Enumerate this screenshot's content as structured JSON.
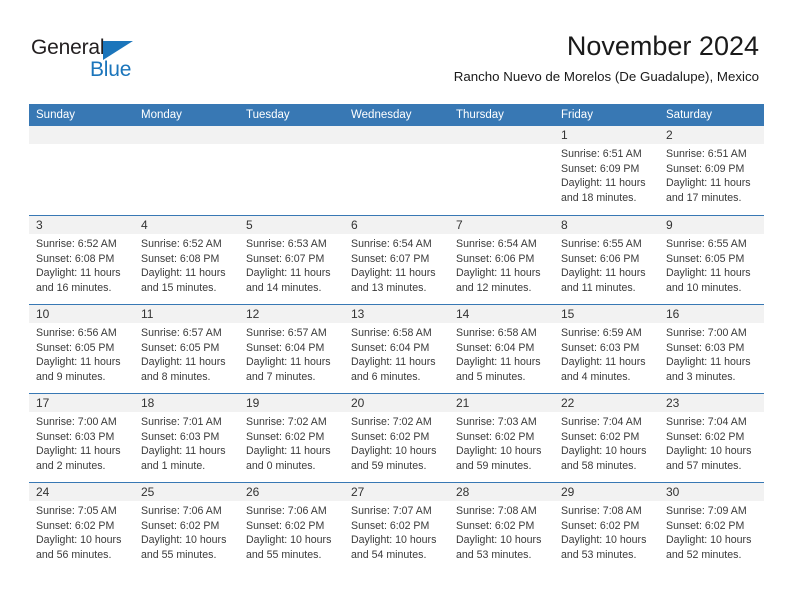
{
  "brand": {
    "name_part1": "General",
    "name_part2": "Blue",
    "accent_color": "#1b75bb"
  },
  "header": {
    "month_title": "November 2024",
    "location": "Rancho Nuevo de Morelos (De Guadalupe), Mexico"
  },
  "calendar": {
    "header_bg": "#3878b4",
    "weekdays": [
      "Sunday",
      "Monday",
      "Tuesday",
      "Wednesday",
      "Thursday",
      "Friday",
      "Saturday"
    ],
    "weeks": [
      [
        {
          "day": "",
          "sunrise": "",
          "sunset": "",
          "daylight": "",
          "empty": true
        },
        {
          "day": "",
          "sunrise": "",
          "sunset": "",
          "daylight": "",
          "empty": true
        },
        {
          "day": "",
          "sunrise": "",
          "sunset": "",
          "daylight": "",
          "empty": true
        },
        {
          "day": "",
          "sunrise": "",
          "sunset": "",
          "daylight": "",
          "empty": true
        },
        {
          "day": "",
          "sunrise": "",
          "sunset": "",
          "daylight": "",
          "empty": true
        },
        {
          "day": "1",
          "sunrise": "Sunrise: 6:51 AM",
          "sunset": "Sunset: 6:09 PM",
          "daylight": "Daylight: 11 hours and 18 minutes.",
          "empty": false
        },
        {
          "day": "2",
          "sunrise": "Sunrise: 6:51 AM",
          "sunset": "Sunset: 6:09 PM",
          "daylight": "Daylight: 11 hours and 17 minutes.",
          "empty": false
        }
      ],
      [
        {
          "day": "3",
          "sunrise": "Sunrise: 6:52 AM",
          "sunset": "Sunset: 6:08 PM",
          "daylight": "Daylight: 11 hours and 16 minutes.",
          "empty": false
        },
        {
          "day": "4",
          "sunrise": "Sunrise: 6:52 AM",
          "sunset": "Sunset: 6:08 PM",
          "daylight": "Daylight: 11 hours and 15 minutes.",
          "empty": false
        },
        {
          "day": "5",
          "sunrise": "Sunrise: 6:53 AM",
          "sunset": "Sunset: 6:07 PM",
          "daylight": "Daylight: 11 hours and 14 minutes.",
          "empty": false
        },
        {
          "day": "6",
          "sunrise": "Sunrise: 6:54 AM",
          "sunset": "Sunset: 6:07 PM",
          "daylight": "Daylight: 11 hours and 13 minutes.",
          "empty": false
        },
        {
          "day": "7",
          "sunrise": "Sunrise: 6:54 AM",
          "sunset": "Sunset: 6:06 PM",
          "daylight": "Daylight: 11 hours and 12 minutes.",
          "empty": false
        },
        {
          "day": "8",
          "sunrise": "Sunrise: 6:55 AM",
          "sunset": "Sunset: 6:06 PM",
          "daylight": "Daylight: 11 hours and 11 minutes.",
          "empty": false
        },
        {
          "day": "9",
          "sunrise": "Sunrise: 6:55 AM",
          "sunset": "Sunset: 6:05 PM",
          "daylight": "Daylight: 11 hours and 10 minutes.",
          "empty": false
        }
      ],
      [
        {
          "day": "10",
          "sunrise": "Sunrise: 6:56 AM",
          "sunset": "Sunset: 6:05 PM",
          "daylight": "Daylight: 11 hours and 9 minutes.",
          "empty": false
        },
        {
          "day": "11",
          "sunrise": "Sunrise: 6:57 AM",
          "sunset": "Sunset: 6:05 PM",
          "daylight": "Daylight: 11 hours and 8 minutes.",
          "empty": false
        },
        {
          "day": "12",
          "sunrise": "Sunrise: 6:57 AM",
          "sunset": "Sunset: 6:04 PM",
          "daylight": "Daylight: 11 hours and 7 minutes.",
          "empty": false
        },
        {
          "day": "13",
          "sunrise": "Sunrise: 6:58 AM",
          "sunset": "Sunset: 6:04 PM",
          "daylight": "Daylight: 11 hours and 6 minutes.",
          "empty": false
        },
        {
          "day": "14",
          "sunrise": "Sunrise: 6:58 AM",
          "sunset": "Sunset: 6:04 PM",
          "daylight": "Daylight: 11 hours and 5 minutes.",
          "empty": false
        },
        {
          "day": "15",
          "sunrise": "Sunrise: 6:59 AM",
          "sunset": "Sunset: 6:03 PM",
          "daylight": "Daylight: 11 hours and 4 minutes.",
          "empty": false
        },
        {
          "day": "16",
          "sunrise": "Sunrise: 7:00 AM",
          "sunset": "Sunset: 6:03 PM",
          "daylight": "Daylight: 11 hours and 3 minutes.",
          "empty": false
        }
      ],
      [
        {
          "day": "17",
          "sunrise": "Sunrise: 7:00 AM",
          "sunset": "Sunset: 6:03 PM",
          "daylight": "Daylight: 11 hours and 2 minutes.",
          "empty": false
        },
        {
          "day": "18",
          "sunrise": "Sunrise: 7:01 AM",
          "sunset": "Sunset: 6:03 PM",
          "daylight": "Daylight: 11 hours and 1 minute.",
          "empty": false
        },
        {
          "day": "19",
          "sunrise": "Sunrise: 7:02 AM",
          "sunset": "Sunset: 6:02 PM",
          "daylight": "Daylight: 11 hours and 0 minutes.",
          "empty": false
        },
        {
          "day": "20",
          "sunrise": "Sunrise: 7:02 AM",
          "sunset": "Sunset: 6:02 PM",
          "daylight": "Daylight: 10 hours and 59 minutes.",
          "empty": false
        },
        {
          "day": "21",
          "sunrise": "Sunrise: 7:03 AM",
          "sunset": "Sunset: 6:02 PM",
          "daylight": "Daylight: 10 hours and 59 minutes.",
          "empty": false
        },
        {
          "day": "22",
          "sunrise": "Sunrise: 7:04 AM",
          "sunset": "Sunset: 6:02 PM",
          "daylight": "Daylight: 10 hours and 58 minutes.",
          "empty": false
        },
        {
          "day": "23",
          "sunrise": "Sunrise: 7:04 AM",
          "sunset": "Sunset: 6:02 PM",
          "daylight": "Daylight: 10 hours and 57 minutes.",
          "empty": false
        }
      ],
      [
        {
          "day": "24",
          "sunrise": "Sunrise: 7:05 AM",
          "sunset": "Sunset: 6:02 PM",
          "daylight": "Daylight: 10 hours and 56 minutes.",
          "empty": false
        },
        {
          "day": "25",
          "sunrise": "Sunrise: 7:06 AM",
          "sunset": "Sunset: 6:02 PM",
          "daylight": "Daylight: 10 hours and 55 minutes.",
          "empty": false
        },
        {
          "day": "26",
          "sunrise": "Sunrise: 7:06 AM",
          "sunset": "Sunset: 6:02 PM",
          "daylight": "Daylight: 10 hours and 55 minutes.",
          "empty": false
        },
        {
          "day": "27",
          "sunrise": "Sunrise: 7:07 AM",
          "sunset": "Sunset: 6:02 PM",
          "daylight": "Daylight: 10 hours and 54 minutes.",
          "empty": false
        },
        {
          "day": "28",
          "sunrise": "Sunrise: 7:08 AM",
          "sunset": "Sunset: 6:02 PM",
          "daylight": "Daylight: 10 hours and 53 minutes.",
          "empty": false
        },
        {
          "day": "29",
          "sunrise": "Sunrise: 7:08 AM",
          "sunset": "Sunset: 6:02 PM",
          "daylight": "Daylight: 10 hours and 53 minutes.",
          "empty": false
        },
        {
          "day": "30",
          "sunrise": "Sunrise: 7:09 AM",
          "sunset": "Sunset: 6:02 PM",
          "daylight": "Daylight: 10 hours and 52 minutes.",
          "empty": false
        }
      ]
    ]
  }
}
